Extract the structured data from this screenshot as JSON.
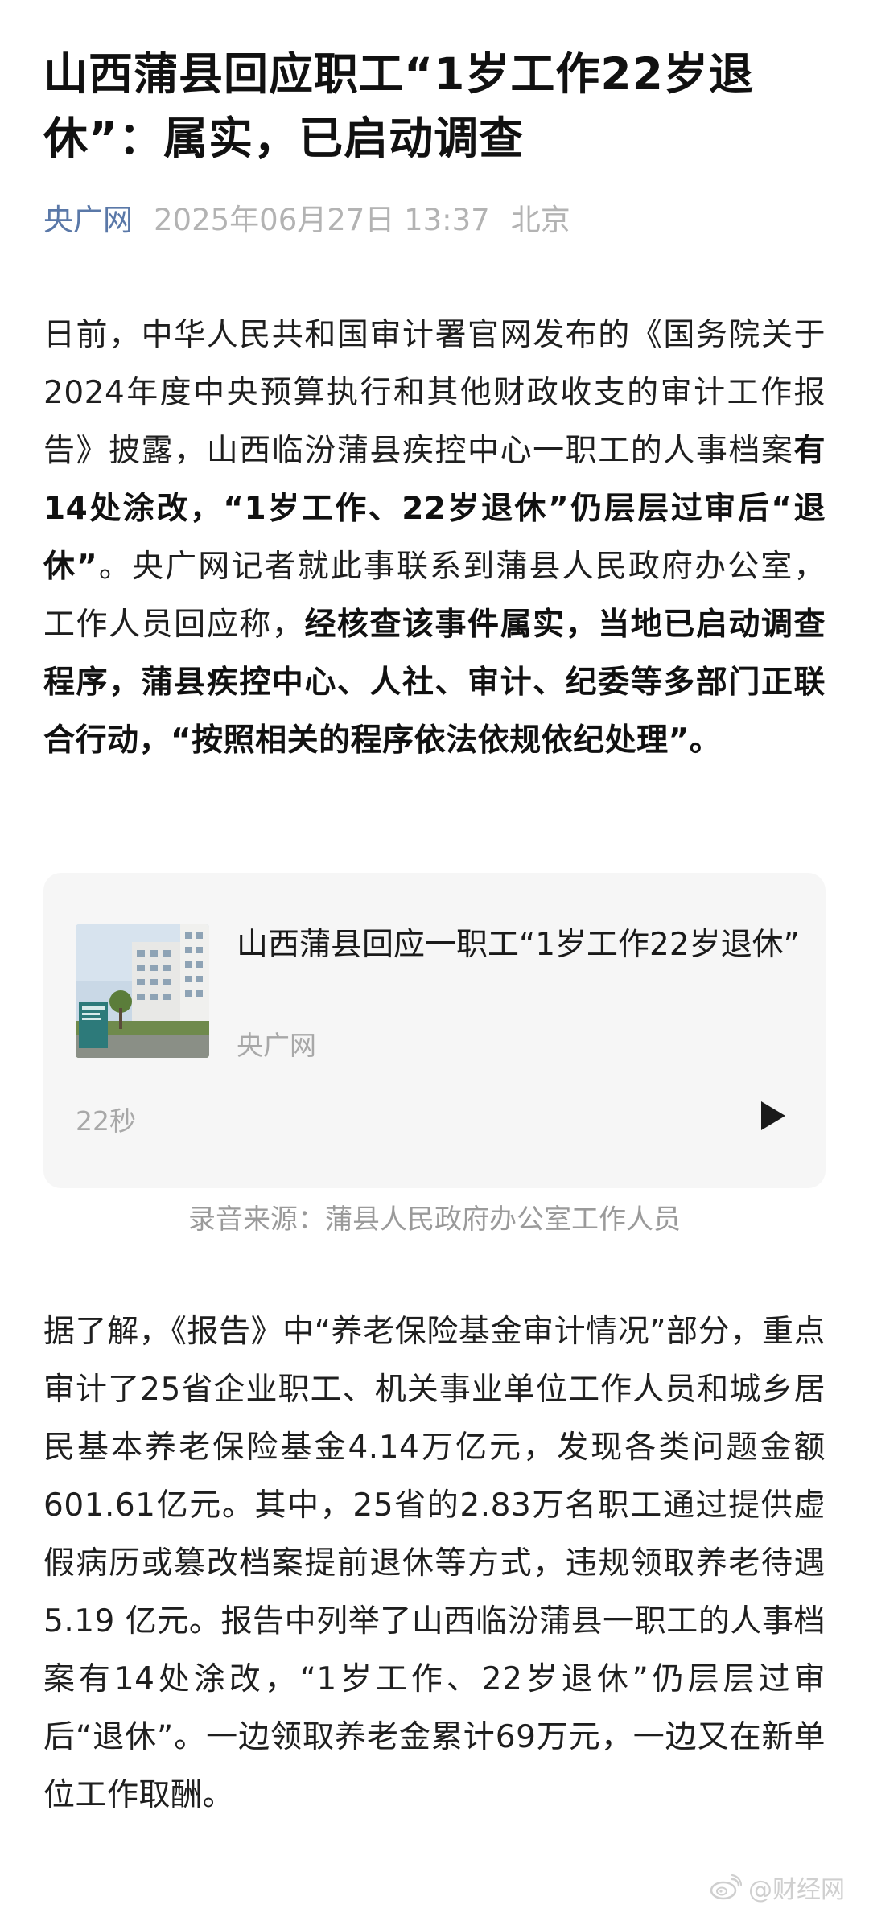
{
  "article": {
    "title": "山西蒲县回应职工“1岁工作22岁退休”：属实，已启动调查",
    "source": "央广网",
    "datetime": "2025年06月27日 13:37",
    "location": "北京"
  },
  "body": {
    "p1_a": "日前，中华人民共和国审计署官网发布的《国务院关于2024年度中央预算执行和其他财政收支的审计工作报告》披露，山西临汾蒲县疾控中心一职工的人事档案",
    "p1_b": "有14处涂改，“1岁工作、22岁退休”仍层层过审后“退休”",
    "p1_c": "。央广网记者就此事联系到蒲县人民政府办公室，工作人员回应称，",
    "p1_d": "经核查该事件属实，当地已启动调查程序，蒲县疾控中心、人社、审计、纪委等多部门正联合行动，“按照相关的程序依法依规依纪处理”",
    "p1_e": "。",
    "p2": "据了解，《报告》中“养老保险基金审计情况”部分，重点审计了25省企业职工、机关事业单位工作人员和城乡居民基本养老保险基金4.14万亿元，发现各类问题金额 601.61亿元。其中，25省的2.83万名职工通过提供虚假病历或篡改档案提前退休等方式，违规领取养老待遇5.19 亿元。报告中列举了山西临汾蒲县一职工的人事档案有14处涂改，“1岁工作、22岁退休”仍层层过审后“退休”。一边领取养老金累计69万元，一边又在新单位工作取酬。"
  },
  "audio_card": {
    "title": "山西蒲县回应一职工“1岁工作22岁退休”",
    "source": "央广网",
    "duration": "22秒",
    "play_icon": "play-icon"
  },
  "caption": "录音来源：蒲县人民政府办公室工作人员",
  "watermark": {
    "text": "@财经网",
    "icon": "weibo-icon"
  },
  "colors": {
    "source_link": "#5a78a8",
    "meta_gray": "#b3b3b3",
    "card_bg": "#f6f6f6"
  }
}
